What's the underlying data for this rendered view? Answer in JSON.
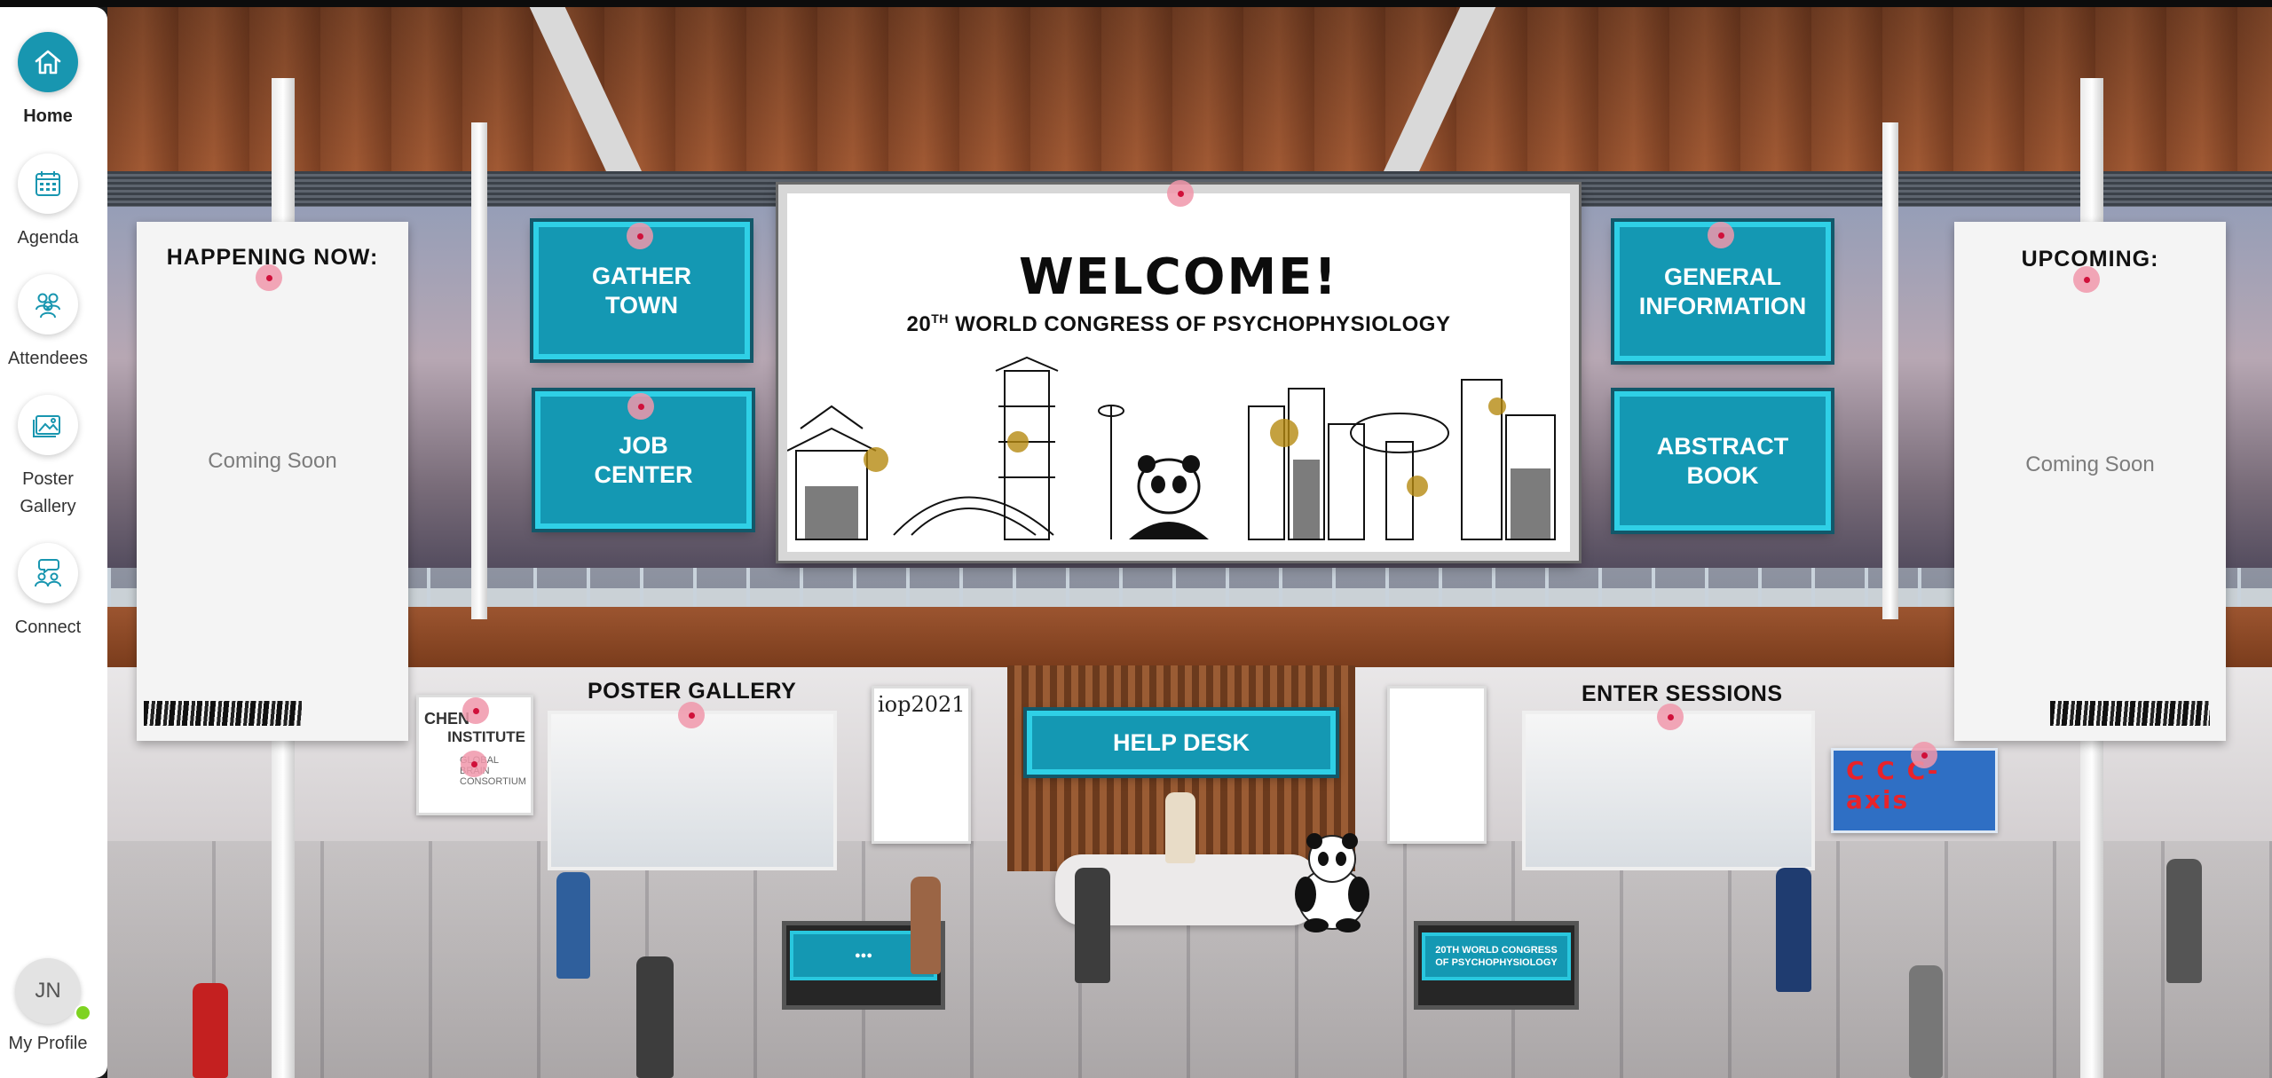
{
  "sidebar": {
    "items": [
      {
        "label": "Home",
        "icon": "home-icon",
        "active": true
      },
      {
        "label": "Agenda",
        "icon": "calendar-icon"
      },
      {
        "label": "Attendees",
        "icon": "people-icon"
      },
      {
        "label": "Poster Gallery",
        "icon": "gallery-icon"
      },
      {
        "label": "Connect",
        "icon": "chat-people-icon"
      }
    ],
    "profile": {
      "initials": "JN",
      "label": "My Profile",
      "status": "online"
    }
  },
  "lobby": {
    "happening_now": {
      "title": "HAPPENING NOW:",
      "body": "Coming Soon"
    },
    "upcoming": {
      "title": "UPCOMING:",
      "body": "Coming Soon"
    },
    "welcome": {
      "title": "WELCOME!",
      "subtitle_prefix": "20",
      "subtitle_sup": "TH",
      "subtitle_rest": " WORLD CONGRESS OF PSYCHOPHYSIOLOGY"
    },
    "screens": {
      "gather_town": [
        "GATHER",
        "TOWN"
      ],
      "job_center": [
        "JOB",
        "CENTER"
      ],
      "general_information": [
        "GENERAL",
        "INFORMATION"
      ],
      "abstract_book": [
        "ABSTRACT",
        "BOOK"
      ]
    },
    "poster_gallery_label": "POSTER GALLERY",
    "enter_sessions_label": "ENTER SESSIONS",
    "help_desk": "HELP DESK",
    "sponsor_chen": [
      "CHEN",
      "INSTITUTE",
      "GLOBAL",
      "BRAIN",
      "CONSORTIUM"
    ],
    "sponsor_ccc": "C C C-axis",
    "iop_poster": "iop2021",
    "kiosk_right": [
      "20TH WORLD CONGRESS",
      "OF PSYCHOPHYSIOLOGY"
    ]
  },
  "colors": {
    "accent": "#1498b3",
    "screen_border": "#2fd0e6",
    "hotspot": "#d0103a",
    "online": "#7ed321"
  }
}
